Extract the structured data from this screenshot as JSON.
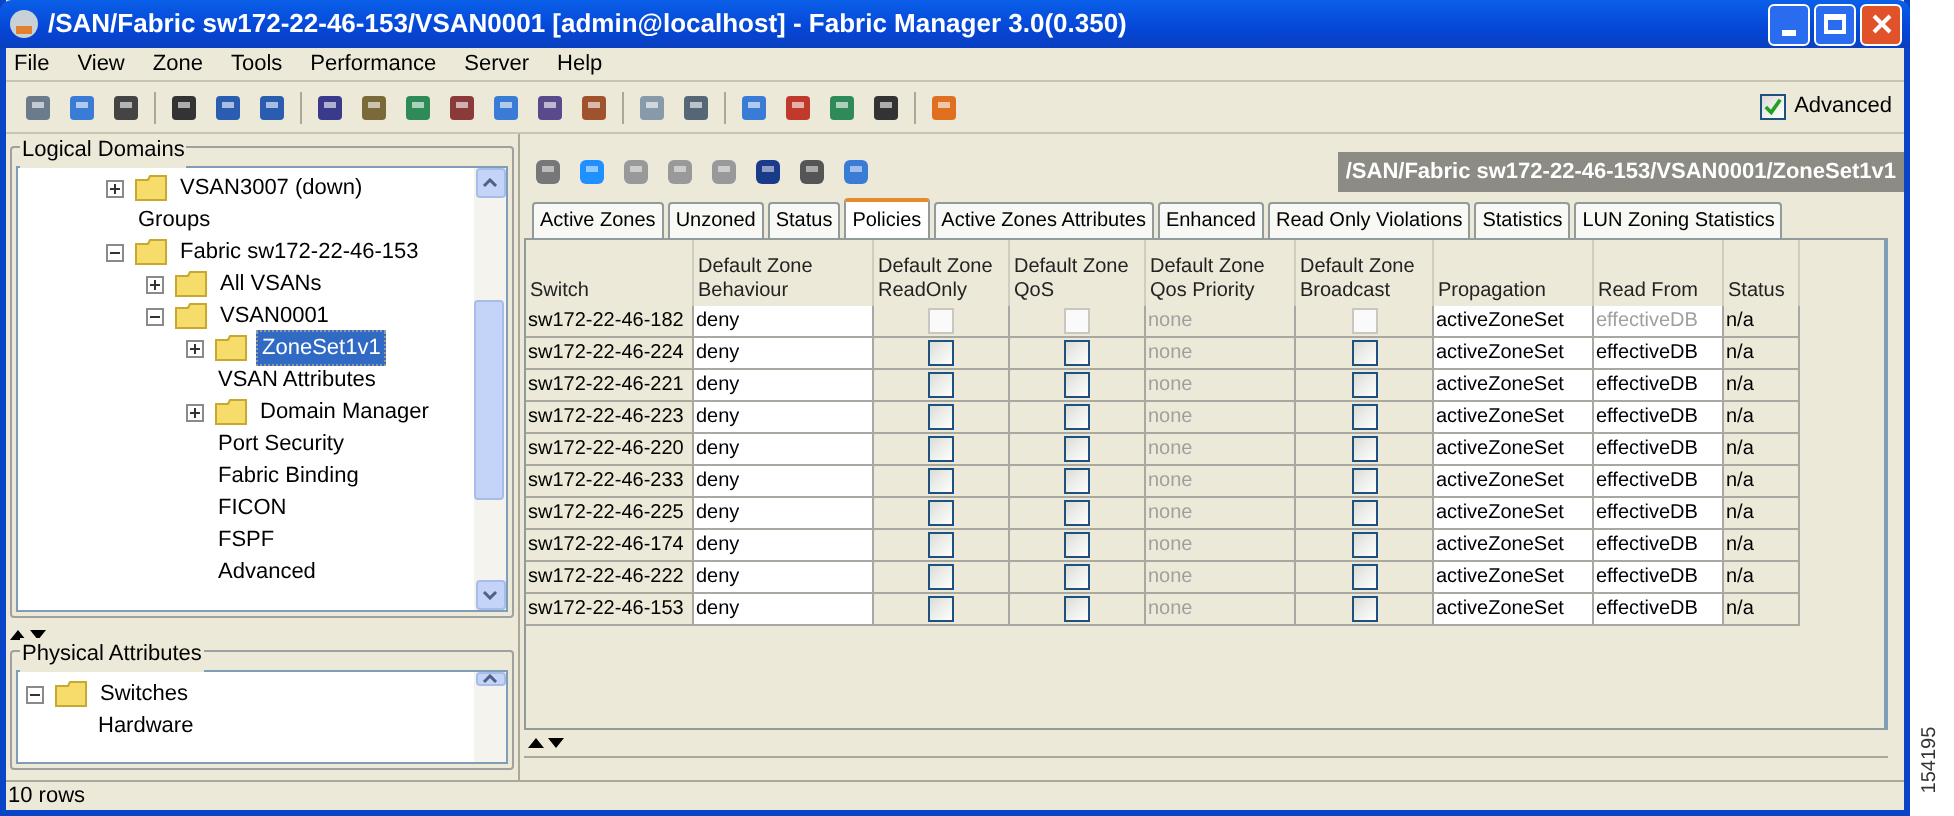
{
  "window": {
    "title": "/SAN/Fabric sw172-22-46-153/VSAN0001 [admin@localhost] - Fabric Manager 3.0(0.350)"
  },
  "menu": [
    "File",
    "View",
    "Zone",
    "Tools",
    "Performance",
    "Server",
    "Help"
  ],
  "advanced": {
    "label": "Advanced",
    "checked": true
  },
  "logical_domains": {
    "title": "Logical Domains",
    "tree": [
      {
        "label": "VSAN3007 (down)",
        "kind": "folder",
        "expanded": false,
        "selected": false
      },
      {
        "label": "Groups",
        "kind": "leaf",
        "selected": false
      },
      {
        "label": "Fabric sw172-22-46-153",
        "kind": "folder",
        "expanded": true,
        "selected": false,
        "children": [
          {
            "label": "All VSANs",
            "kind": "folder",
            "expanded": false,
            "selected": false
          },
          {
            "label": "VSAN0001",
            "kind": "folder",
            "expanded": true,
            "selected": false,
            "children": [
              {
                "label": "ZoneSet1v1",
                "kind": "folder",
                "expanded": false,
                "selected": true
              },
              {
                "label": "VSAN Attributes",
                "kind": "leaf",
                "selected": false
              },
              {
                "label": "Domain Manager",
                "kind": "folder",
                "expanded": false,
                "selected": false
              },
              {
                "label": "Port Security",
                "kind": "leaf",
                "selected": false
              },
              {
                "label": "Fabric Binding",
                "kind": "leaf",
                "selected": false
              },
              {
                "label": "FICON",
                "kind": "leaf",
                "selected": false
              },
              {
                "label": "FSPF",
                "kind": "leaf",
                "selected": false
              },
              {
                "label": "Advanced",
                "kind": "leaf",
                "selected": false
              }
            ]
          }
        ]
      }
    ]
  },
  "physical_attributes": {
    "title": "Physical Attributes",
    "tree": [
      {
        "label": "Switches",
        "kind": "folder",
        "expanded": true,
        "selected": false,
        "children": [
          {
            "label": "Hardware",
            "kind": "leaf",
            "selected": false
          }
        ]
      }
    ]
  },
  "path": "/SAN/Fabric sw172-22-46-153/VSAN0001/ZoneSet1v1",
  "tabs": [
    {
      "label": "Active Zones",
      "selected": false
    },
    {
      "label": "Unzoned",
      "selected": false
    },
    {
      "label": "Status",
      "selected": false
    },
    {
      "label": "Policies",
      "selected": true
    },
    {
      "label": "Active Zones Attributes",
      "selected": false
    },
    {
      "label": "Enhanced",
      "selected": false
    },
    {
      "label": "Read Only Violations",
      "selected": false
    },
    {
      "label": "Statistics",
      "selected": false
    },
    {
      "label": "LUN Zoning Statistics",
      "selected": false
    }
  ],
  "table": {
    "columns": [
      [
        "Switch"
      ],
      [
        "Default Zone",
        "Behaviour"
      ],
      [
        "Default Zone",
        "ReadOnly"
      ],
      [
        "Default Zone",
        "QoS"
      ],
      [
        "Default Zone",
        "Qos Priority"
      ],
      [
        "Default Zone",
        "Broadcast"
      ],
      [
        "Propagation"
      ],
      [
        "Read From"
      ],
      [
        "Status"
      ]
    ],
    "rows": [
      {
        "switch": "sw172-22-46-182",
        "behaviour": "deny",
        "read_only": false,
        "qos": false,
        "qos_priority": "none",
        "broadcast": false,
        "propagation": "activeZoneSet",
        "read_from": "effectiveDB",
        "status": "n/a",
        "disabled": true
      },
      {
        "switch": "sw172-22-46-224",
        "behaviour": "deny",
        "read_only": false,
        "qos": false,
        "qos_priority": "none",
        "broadcast": false,
        "propagation": "activeZoneSet",
        "read_from": "effectiveDB",
        "status": "n/a",
        "disabled": false
      },
      {
        "switch": "sw172-22-46-221",
        "behaviour": "deny",
        "read_only": false,
        "qos": false,
        "qos_priority": "none",
        "broadcast": false,
        "propagation": "activeZoneSet",
        "read_from": "effectiveDB",
        "status": "n/a",
        "disabled": false
      },
      {
        "switch": "sw172-22-46-223",
        "behaviour": "deny",
        "read_only": false,
        "qos": false,
        "qos_priority": "none",
        "broadcast": false,
        "propagation": "activeZoneSet",
        "read_from": "effectiveDB",
        "status": "n/a",
        "disabled": false
      },
      {
        "switch": "sw172-22-46-220",
        "behaviour": "deny",
        "read_only": false,
        "qos": false,
        "qos_priority": "none",
        "broadcast": false,
        "propagation": "activeZoneSet",
        "read_from": "effectiveDB",
        "status": "n/a",
        "disabled": false
      },
      {
        "switch": "sw172-22-46-233",
        "behaviour": "deny",
        "read_only": false,
        "qos": false,
        "qos_priority": "none",
        "broadcast": false,
        "propagation": "activeZoneSet",
        "read_from": "effectiveDB",
        "status": "n/a",
        "disabled": false
      },
      {
        "switch": "sw172-22-46-225",
        "behaviour": "deny",
        "read_only": false,
        "qos": false,
        "qos_priority": "none",
        "broadcast": false,
        "propagation": "activeZoneSet",
        "read_from": "effectiveDB",
        "status": "n/a",
        "disabled": false
      },
      {
        "switch": "sw172-22-46-174",
        "behaviour": "deny",
        "read_only": false,
        "qos": false,
        "qos_priority": "none",
        "broadcast": false,
        "propagation": "activeZoneSet",
        "read_from": "effectiveDB",
        "status": "n/a",
        "disabled": false
      },
      {
        "switch": "sw172-22-46-222",
        "behaviour": "deny",
        "read_only": false,
        "qos": false,
        "qos_priority": "none",
        "broadcast": false,
        "propagation": "activeZoneSet",
        "read_from": "effectiveDB",
        "status": "n/a",
        "disabled": false
      },
      {
        "switch": "sw172-22-46-153",
        "behaviour": "deny",
        "read_only": false,
        "qos": false,
        "qos_priority": "none",
        "broadcast": false,
        "propagation": "activeZoneSet",
        "read_from": "effectiveDB",
        "status": "n/a",
        "disabled": false
      }
    ]
  },
  "status_bar": "10 rows",
  "figure_number": "154195"
}
